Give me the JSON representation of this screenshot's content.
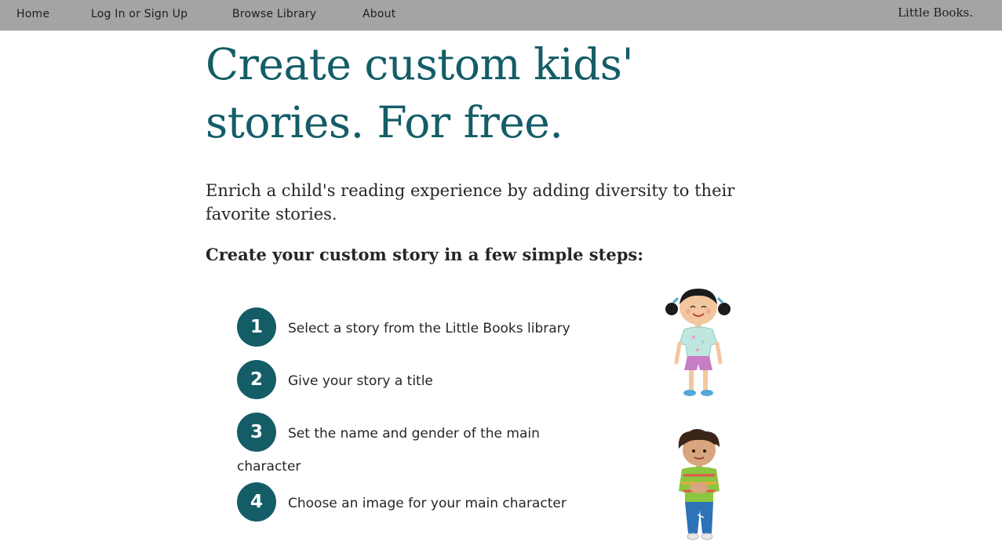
{
  "nav": {
    "items": [
      {
        "label": "Home"
      },
      {
        "label": "Log In or Sign Up"
      },
      {
        "label": "Browse Library"
      },
      {
        "label": "About"
      }
    ],
    "brand": "Little Books."
  },
  "hero": {
    "title_line1": "Create custom kids'",
    "title_line2": "stories. For free."
  },
  "intro": "Enrich a child's reading experience by adding diversity to their favorite stories.",
  "steps_heading": "Create your custom story in a few simple steps:",
  "steps": [
    {
      "number": "1",
      "text": "Select a story from the Little Books library"
    },
    {
      "number": "2",
      "text": "Give your story a title"
    },
    {
      "number": "3",
      "text": "Set the name and gender of the main",
      "text_wrap": "character"
    },
    {
      "number": "4",
      "text": "Choose an image for your main character"
    }
  ],
  "colors": {
    "accent": "#145d67",
    "nav_background": "#a4a4a4"
  }
}
